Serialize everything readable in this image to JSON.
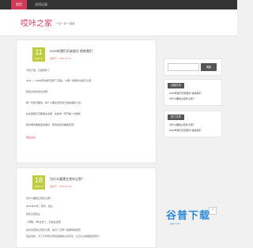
{
  "nav": {
    "items": [
      {
        "label": "首页",
        "active": true
      },
      {
        "label": "访问记录",
        "active": false
      }
    ]
  },
  "site": {
    "title": "哎咔之家",
    "tagline": "一位一步一追逐"
  },
  "posts": [
    {
      "day": "11",
      "month": "2020-11",
      "title": "2020年我们天安部分 哈哈我们",
      "meta": "发布于：2020-11-11",
      "paragraphs": [
        "不知不觉，已经到年了",
        "2011——2020年哈我们经历了很多，以哪一些事件在我们心里",
        "哈哈过去的就过去吧",
        "每一天我们都在，每个人都在经历自己的故事和人生！",
        "在这里把它们都收在这里，在新的一年开始一切重新",
        "希望明年都能变的更好，所有的目标都能实现！"
      ],
      "readmore": "阅读全文"
    },
    {
      "day": "18",
      "month": "2020-10",
      "title": "为什么要建立哎咔之家？",
      "meta": "发布于：2020-10-18",
      "paragraphs": [
        "为什么要建立哎咔之家？",
        "2011年10月，哎咔，建立",
        "哎咔之家建立",
        "一转眼，8年过去了，还是在这里",
        "这次决定建立哎咔之家，是为了记录一些事情和经历",
        "还是当中，为了平时有记录点和留言以及评论，让日子过得更加有意义"
      ],
      "readmore": ""
    }
  ],
  "sidebar": {
    "search_button": "搜索",
    "widgets": [
      {
        "title": "近期文章",
        "links": [
          "2020年我们天安部分 哈哈我们",
          "为什么要建立哎咔之家？"
        ]
      },
      {
        "title": "热门文章",
        "links": [
          "为什么要建立哎咔之家？",
          "2020年我们天安部分 哈哈我们"
        ]
      }
    ]
  },
  "watermark": {
    "text": "谷普下载",
    "sub": "ggpu.com"
  },
  "back_to_top": "⌃"
}
